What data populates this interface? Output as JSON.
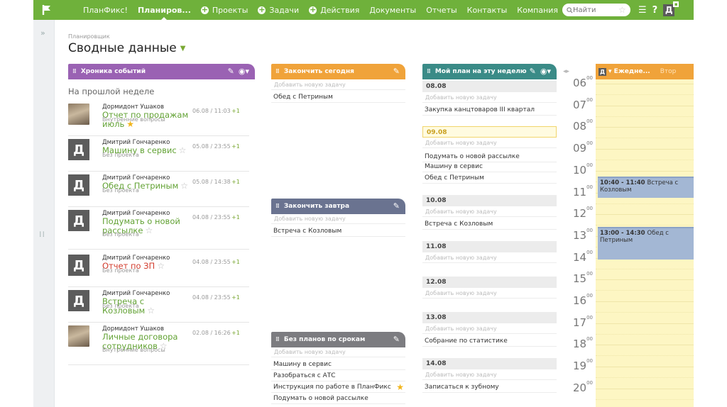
{
  "topbar": {
    "logo_icon": "flag-icon",
    "nav": [
      {
        "label": "ПланФикс!",
        "icon": ""
      },
      {
        "label": "Планиров...",
        "icon": "",
        "active": true
      },
      {
        "label": "Проекты",
        "icon": "plus-icon"
      },
      {
        "label": "Задачи",
        "icon": "plus-icon"
      },
      {
        "label": "Действия",
        "icon": "plus-icon"
      },
      {
        "label": "Документы",
        "icon": ""
      },
      {
        "label": "Отчеты",
        "icon": ""
      },
      {
        "label": "Контакты",
        "icon": ""
      },
      {
        "label": "Компания",
        "icon": ""
      }
    ],
    "search_placeholder": "Найти",
    "avatar_letter": "Д",
    "menu_icon": "hamburger-icon",
    "help_icon": "question-icon",
    "accent": "#6fb13b"
  },
  "breadcrumb": "Планировщик",
  "page_title": "Сводные данные",
  "events": {
    "header": "Хроника событий",
    "section": "На прошлой неделе",
    "color": "#9a62b3",
    "items": [
      {
        "author": "Дормидонт Ушаков",
        "title": "Отчет по продажам июль",
        "project": "Внутренние вопросы",
        "time": "06.08 / 11:03",
        "plus": "+1",
        "starred": true,
        "avatar": "photo"
      },
      {
        "author": "Дмитрий Гончаренко",
        "title": "Машину в сервис",
        "project": "Без проекта",
        "time": "05.08 / 23:55",
        "plus": "+1",
        "starred": false,
        "avatar": "Д"
      },
      {
        "author": "Дмитрий Гончаренко",
        "title": "Обед с Петриным",
        "project": "Без проекта",
        "time": "05.08 / 14:38",
        "plus": "+1",
        "starred": false,
        "avatar": "Д"
      },
      {
        "author": "Дмитрий Гончаренко",
        "title": "Подумать о новой рассылке",
        "project": "Без проекта",
        "time": "04.08 / 23:55",
        "plus": "+1",
        "starred": false,
        "avatar": "Д"
      },
      {
        "author": "Дмитрий Гончаренко",
        "title": "Отчет по ЗП",
        "project": "Без проекта",
        "time": "04.08 / 23:55",
        "plus": "+1",
        "starred": false,
        "avatar": "Д"
      },
      {
        "author": "Дмитрий Гончаренко",
        "title": "Встреча с Козловым",
        "project": "Без проекта",
        "time": "04.08 / 23:55",
        "plus": "+1",
        "starred": false,
        "avatar": "Д"
      },
      {
        "author": "Дормидонт Ушаков",
        "title": "Личные договора сотрудников",
        "project": "Внутренние вопросы",
        "time": "02.08 / 16:26",
        "plus": "+1",
        "starred": false,
        "avatar": "photo"
      }
    ]
  },
  "today": {
    "header": "Закончить сегодня",
    "add": "Добавить новую задачу",
    "tasks": [
      "Обед с Петриным"
    ],
    "color": "#f0a33a"
  },
  "tomorrow": {
    "header": "Закончить завтра",
    "add": "Добавить новую задачу",
    "tasks": [
      "Встреча с Козловым"
    ],
    "color": "#6a7390"
  },
  "noplan": {
    "header": "Без планов по срокам",
    "add": "Добавить новую задачу",
    "tasks": [
      "Машину в сервис",
      "Разобраться с АТС",
      "Инструкция по работе в ПланФикс",
      "Подумать о новой рассылке"
    ],
    "starred_index": 2,
    "color": "#7c7c80"
  },
  "week": {
    "header": "Мой план на эту неделю",
    "color": "#3a8b87",
    "add": "Добавить новую задачу",
    "days": [
      {
        "date": "08.08",
        "today": false,
        "tasks": [
          "Закупка канцтоваров III квартал"
        ]
      },
      {
        "date": "09.08",
        "today": true,
        "tasks": [
          "Подумать о новой рассылке",
          "Машину в сервис",
          "Обед с Петриным"
        ]
      },
      {
        "date": "10.08",
        "today": false,
        "tasks": [
          "Встреча с Козловым"
        ]
      },
      {
        "date": "11.08",
        "today": false,
        "tasks": []
      },
      {
        "date": "12.08",
        "today": false,
        "tasks": []
      },
      {
        "date": "13.08",
        "today": false,
        "tasks": [
          "Собрание по статистике"
        ]
      },
      {
        "date": "14.08",
        "today": false,
        "tasks": [
          "Записаться к зубному"
        ]
      }
    ]
  },
  "calendar": {
    "header_letter": "Д",
    "header": "Ежедне...",
    "header2": "Втор",
    "hours": [
      "06",
      "07",
      "08",
      "09",
      "10",
      "11",
      "12",
      "13",
      "14",
      "15",
      "16",
      "17",
      "18",
      "19",
      "20"
    ],
    "minutes": "00",
    "events": [
      {
        "time": "10:40 - 11:40",
        "title": "Встреча с Козловым"
      },
      {
        "time": "13:00 - 14:30",
        "title": "Обед с Петриным"
      }
    ]
  }
}
